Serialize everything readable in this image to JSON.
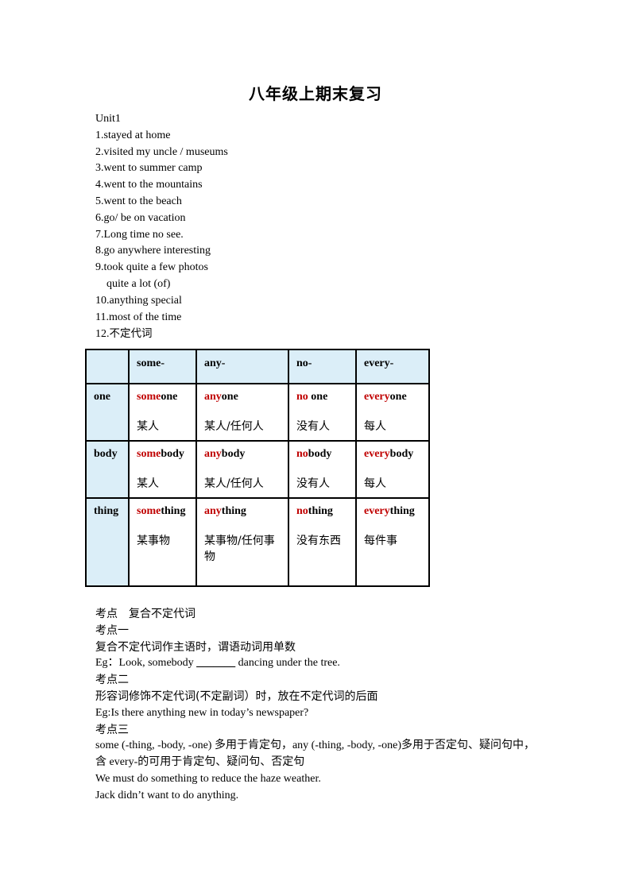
{
  "title": "八年级上期末复习",
  "unit": "Unit1",
  "items": [
    "1.stayed at home",
    "2.visited my uncle / museums",
    "3.went to summer camp",
    "4.went to the mountains",
    "5.went to the beach",
    "6.go/ be on vacation",
    "7.Long time no see.",
    "8.go anywhere interesting",
    "9.took quite a few photos",
    "quite a lot (of)",
    "10.anything special",
    "11.most of the time"
  ],
  "item12": {
    "num": "12.",
    "text": "不定代词"
  },
  "table": {
    "highlight_color": "#c00000",
    "header_bg": "#dbeef8",
    "columns": [
      "",
      "some-",
      "any-",
      "no-",
      "every-"
    ],
    "rows": [
      {
        "head": "one",
        "cells": [
          {
            "prefix": "some",
            "suffix": "one",
            "meaning": "某人"
          },
          {
            "prefix": "any",
            "suffix": "one",
            "meaning": "某人/任何人"
          },
          {
            "prefix": "no",
            "suffix": " one",
            "meaning": "没有人"
          },
          {
            "prefix": "every",
            "suffix": "one",
            "meaning": "每人"
          }
        ]
      },
      {
        "head": "body",
        "cells": [
          {
            "prefix": "some",
            "suffix": "body",
            "meaning": "某人"
          },
          {
            "prefix": "any",
            "suffix": "body",
            "meaning": "某人/任何人"
          },
          {
            "prefix": "no",
            "suffix": "body",
            "meaning": "没有人"
          },
          {
            "prefix": "every",
            "suffix": "body",
            "meaning": "每人"
          }
        ]
      },
      {
        "head": "thing",
        "cells": [
          {
            "prefix": "some",
            "suffix": "thing",
            "meaning": "某事物"
          },
          {
            "prefix": "any",
            "suffix": "thing",
            "meaning": "某事物/任何事物"
          },
          {
            "prefix": "no",
            "suffix": "thing",
            "meaning": "没有东西"
          },
          {
            "prefix": "every",
            "suffix": "thing",
            "meaning": "每件事"
          }
        ]
      }
    ]
  },
  "notes": {
    "heading": "考点　复合不定代词",
    "point1_title": "考点一",
    "point1_rule": "复合不定代词作主语时，谓语动词用单数",
    "point1_eg_pre": "Eg：Look, somebody ",
    "point1_eg_blank": "_______",
    "point1_eg_post": " dancing under the tree.",
    "point2_title": "考点二",
    "point2_rule": "形容词修饰不定代词(不定副词）时，放在不定代词的后面",
    "point2_eg": "Eg:Is there anything new in today’s newspaper?",
    "point3_title": "考点三",
    "point3_rule_a": "some (-thing, -body, -one) 多用于肯定句，any (-thing, -body, -one)多用于否定句、疑问句中，",
    "point3_rule_b": "含 every-的可用于肯定句、疑问句、否定句",
    "point3_eg1": "We must do something to reduce the haze weather.",
    "point3_eg2": "Jack didn’t want to do anything."
  }
}
